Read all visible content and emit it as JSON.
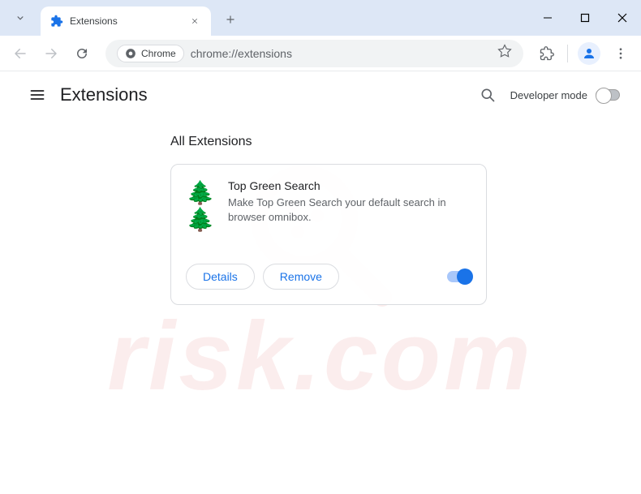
{
  "tab": {
    "title": "Extensions"
  },
  "omnibox": {
    "chip": "Chrome",
    "url": "chrome://extensions"
  },
  "header": {
    "title": "Extensions",
    "dev_mode_label": "Developer mode"
  },
  "section": {
    "title": "All Extensions"
  },
  "extension": {
    "name": "Top Green Search",
    "description": "Make Top Green Search your default search in browser omnibox.",
    "icon": "🌲🌲",
    "details_label": "Details",
    "remove_label": "Remove",
    "enabled": true
  },
  "watermark": {
    "text": "risk.com"
  }
}
